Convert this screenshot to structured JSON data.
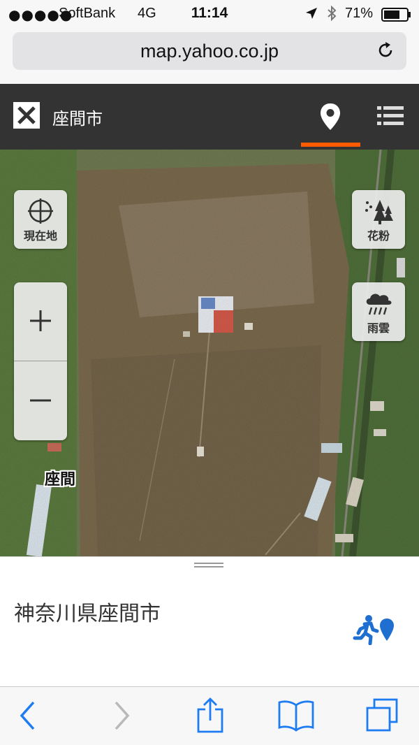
{
  "status_bar": {
    "signal": "●●●●●",
    "carrier": "SoftBank",
    "network": "4G",
    "time": "11:14",
    "battery": "71%",
    "battery_level": 0.71
  },
  "browser": {
    "url": "map.yahoo.co.jp"
  },
  "map_header": {
    "title": "座間市",
    "active_tab": "map-pin",
    "accent_color": "#ff5a00"
  },
  "map": {
    "controls": {
      "locate_label": "現在地",
      "pollen_label": "花粉",
      "rain_label": "雨雲",
      "zoom_in": "+",
      "zoom_out": "−"
    },
    "place_label": "座間"
  },
  "info_panel": {
    "address": "神奈川県座間市",
    "route_icon_color": "#1f6fd0"
  },
  "toolbar": {
    "icons": [
      "back-icon",
      "forward-icon",
      "share-icon",
      "bookmarks-icon",
      "tabs-icon"
    ],
    "icon_color": "#1e7cf2"
  }
}
